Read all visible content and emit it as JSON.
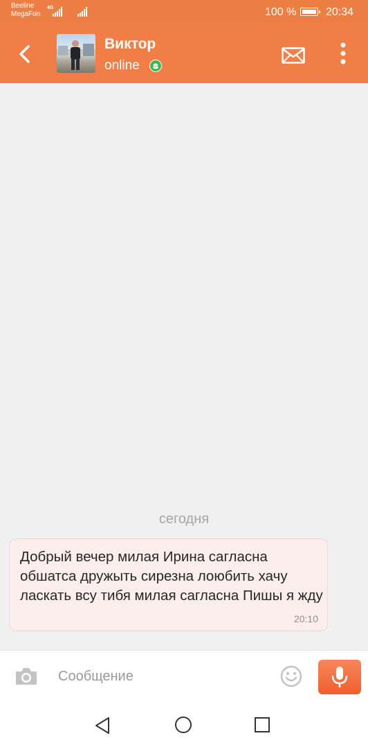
{
  "status_bar": {
    "carrier_1": "Beeline",
    "carrier_2": "MegaFon",
    "network_type": "4G",
    "battery_percent": "100 %",
    "time": "20:34"
  },
  "header": {
    "contact_name": "Виктор",
    "status": "online",
    "icons": {
      "back": "back-chevron-icon",
      "avatar": "contact-photo",
      "online_badge": "android-icon",
      "mail": "mail-icon",
      "more": "more-vertical-icon"
    },
    "colors": {
      "background": "#f07e46",
      "online_badge": "#3eb74a"
    }
  },
  "chat": {
    "date_separator": "сегодня",
    "messages": [
      {
        "text": "Добрый вечер милая Ирина сагласна обшатса дружыть сирезна лоюбить хачу ласкать всу тибя милая сагласна Пишы я жду",
        "time": "20:10"
      }
    ]
  },
  "composer": {
    "placeholder": "Сообщение",
    "value": "",
    "icons": {
      "camera": "camera-icon",
      "emoji": "emoji-icon",
      "mic": "microphone-icon"
    },
    "mic_button_color": "#f26a3a"
  },
  "nav_bar": {
    "icons": {
      "back": "nav-back-icon",
      "home": "nav-home-icon",
      "recent": "nav-recents-icon"
    }
  }
}
